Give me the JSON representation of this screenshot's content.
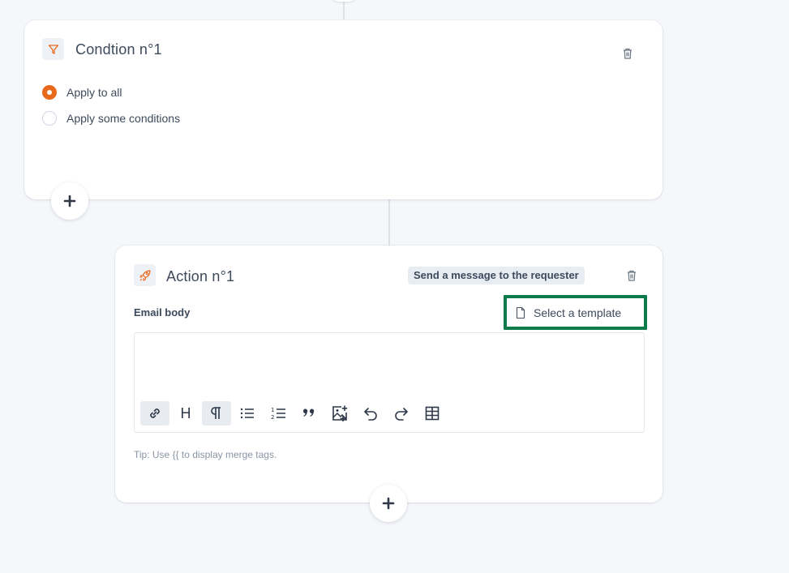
{
  "colors": {
    "accent": "#e8691b",
    "highlight": "#0c7a4b",
    "background": "#f5f7fa",
    "card": "#ffffff",
    "text": "#3d4a5c"
  },
  "condition": {
    "title": "Condtion n°1",
    "icon": "filter-icon",
    "options": [
      {
        "label": "Apply to all",
        "checked": true
      },
      {
        "label": "Apply some conditions",
        "checked": false
      }
    ]
  },
  "action": {
    "title": "Action n°1",
    "icon": "rocket-icon",
    "type_badge": "Send a message to the requester",
    "email_body_label": "Email body",
    "select_template_label": "Select a template",
    "editor_value": "",
    "toolbar": [
      "link-icon",
      "heading-icon",
      "paragraph-icon",
      "bullet-list-icon",
      "ordered-list-icon",
      "quote-icon",
      "image-add-icon",
      "undo-icon",
      "redo-icon",
      "table-icon"
    ],
    "heading_glyph": "H",
    "tip": "Tip: Use {{ to display merge tags."
  }
}
